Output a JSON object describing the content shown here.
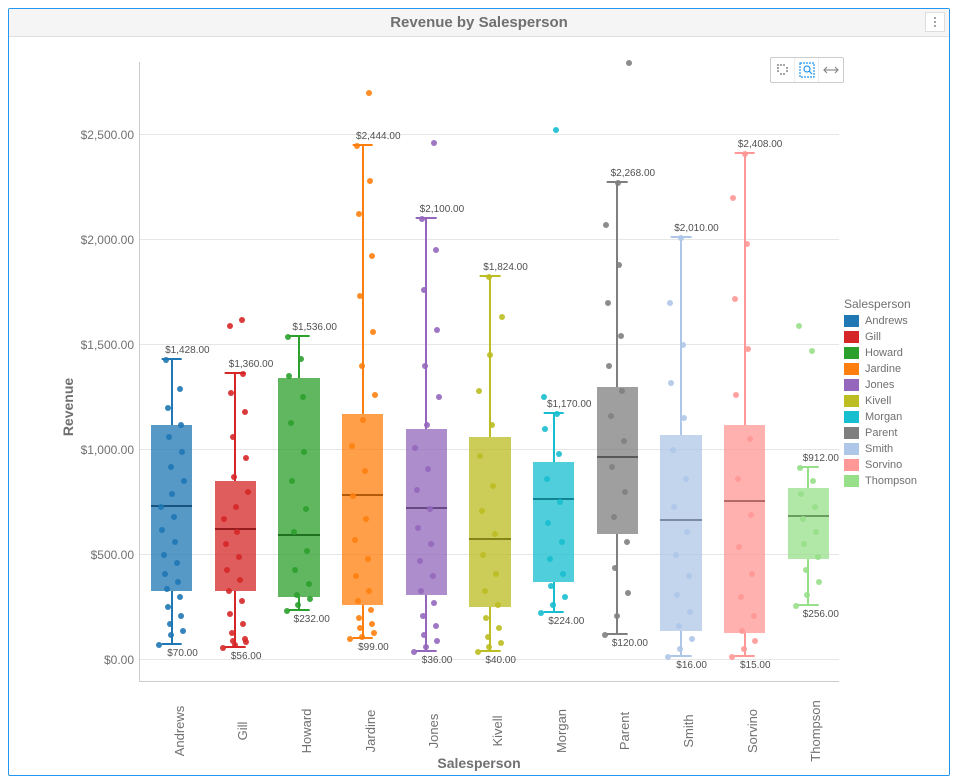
{
  "title": "Revenue by Salesperson",
  "y_axis_title": "Revenue",
  "x_axis_title": "Salesperson",
  "legend_title": "Salesperson",
  "y_ticks": [
    {
      "v": 0,
      "label": "$0.00"
    },
    {
      "v": 500,
      "label": "$500.00"
    },
    {
      "v": 1000,
      "label": "$1,000.00"
    },
    {
      "v": 1500,
      "label": "$1,500.00"
    },
    {
      "v": 2000,
      "label": "$2,000.00"
    },
    {
      "v": 2500,
      "label": "$2,500.00"
    }
  ],
  "chart_data": {
    "type": "boxplot",
    "xlabel": "Salesperson",
    "ylabel": "Revenue",
    "title": "Revenue by Salesperson",
    "ylim": [
      -100,
      2850
    ],
    "series": [
      {
        "name": "Andrews",
        "color": "#1f77b4",
        "min": 70,
        "q1": 330,
        "median": 730,
        "q3": 1120,
        "max": 1428,
        "max_label": "$1,428.00",
        "min_label": "$70.00",
        "points": [
          70,
          120,
          140,
          170,
          210,
          250,
          300,
          340,
          370,
          410,
          460,
          500,
          560,
          620,
          680,
          730,
          790,
          850,
          920,
          990,
          1060,
          1120,
          1200,
          1290,
          1428
        ]
      },
      {
        "name": "Gill",
        "color": "#d62728",
        "min": 56,
        "q1": 330,
        "median": 620,
        "q3": 850,
        "max": 1360,
        "max_label": "$1,360.00",
        "min_label": "$56.00",
        "points": [
          56,
          70,
          85,
          90,
          100,
          130,
          170,
          220,
          280,
          330,
          380,
          430,
          490,
          550,
          610,
          670,
          730,
          800,
          870,
          960,
          1060,
          1180,
          1270,
          1360,
          1590,
          1620
        ],
        "outliers": [
          1590,
          1620
        ]
      },
      {
        "name": "Howard",
        "color": "#2ca02c",
        "min": 232,
        "q1": 300,
        "median": 590,
        "q3": 1340,
        "max": 1536,
        "max_label": "$1,536.00",
        "min_label": "$232.00",
        "points": [
          232,
          260,
          290,
          310,
          360,
          430,
          520,
          610,
          720,
          850,
          990,
          1130,
          1250,
          1350,
          1430,
          1536
        ]
      },
      {
        "name": "Jardine",
        "color": "#ff7f0e",
        "min": 99,
        "q1": 260,
        "median": 780,
        "q3": 1170,
        "max": 2444,
        "max_label": "$2,444.00",
        "min_label": "$99.00",
        "points": [
          99,
          110,
          130,
          150,
          170,
          200,
          240,
          280,
          330,
          400,
          480,
          570,
          670,
          780,
          900,
          1020,
          1140,
          1260,
          1400,
          1560,
          1730,
          1920,
          2120,
          2280,
          2444,
          2700
        ],
        "outliers": [
          2700
        ]
      },
      {
        "name": "Jones",
        "color": "#9467bd",
        "min": 36,
        "q1": 310,
        "median": 720,
        "q3": 1100,
        "max": 2100,
        "max_label": "$2,100.00",
        "min_label": "$36.00",
        "points": [
          36,
          60,
          90,
          120,
          160,
          210,
          270,
          330,
          400,
          470,
          550,
          630,
          720,
          810,
          910,
          1010,
          1120,
          1250,
          1400,
          1570,
          1760,
          1950,
          2100,
          2460
        ],
        "outliers": [
          2460
        ]
      },
      {
        "name": "Kivell",
        "color": "#bcbd22",
        "min": 40,
        "q1": 250,
        "median": 570,
        "q3": 1060,
        "max": 1824,
        "max_label": "$1,824.00",
        "min_label": "$40.00",
        "points": [
          40,
          60,
          80,
          110,
          150,
          200,
          260,
          330,
          410,
          500,
          600,
          710,
          830,
          970,
          1120,
          1280,
          1450,
          1630,
          1824
        ]
      },
      {
        "name": "Morgan",
        "color": "#17becf",
        "min": 224,
        "q1": 370,
        "median": 760,
        "q3": 940,
        "max": 1170,
        "max_label": "$1,170.00",
        "min_label": "$224.00",
        "points": [
          224,
          260,
          300,
          350,
          410,
          480,
          560,
          650,
          750,
          860,
          980,
          1100,
          1170,
          1250,
          2520
        ],
        "outliers": [
          1250,
          2520
        ]
      },
      {
        "name": "Parent",
        "color": "#7f7f7f",
        "min": 120,
        "q1": 600,
        "median": 960,
        "q3": 1300,
        "max": 2268,
        "max_label": "$2,268.00",
        "min_label": "$120.00",
        "points": [
          120,
          210,
          320,
          440,
          560,
          680,
          800,
          920,
          1040,
          1160,
          1280,
          1400,
          1540,
          1700,
          1880,
          2070,
          2268,
          2840
        ],
        "outliers": [
          2840
        ]
      },
      {
        "name": "Smith",
        "color": "#aec7e8",
        "min": 16,
        "q1": 140,
        "median": 660,
        "q3": 1070,
        "max": 2010,
        "max_label": "$2,010.00",
        "min_label": "$16.00",
        "points": [
          16,
          50,
          100,
          160,
          230,
          310,
          400,
          500,
          610,
          730,
          860,
          1000,
          1150,
          1320,
          1500,
          1700,
          2010
        ]
      },
      {
        "name": "Sorvino",
        "color": "#ff9896",
        "min": 15,
        "q1": 130,
        "median": 750,
        "q3": 1120,
        "max": 2408,
        "max_label": "$2,408.00",
        "min_label": "$15.00",
        "points": [
          15,
          50,
          90,
          140,
          210,
          300,
          410,
          540,
          690,
          860,
          1050,
          1260,
          1480,
          1720,
          1980,
          2200,
          2408
        ]
      },
      {
        "name": "Thompson",
        "color": "#98df8a",
        "min": 256,
        "q1": 480,
        "median": 680,
        "q3": 820,
        "max": 912,
        "max_label": "$912.00",
        "min_label": "$256.00",
        "points": [
          256,
          310,
          370,
          430,
          490,
          550,
          610,
          670,
          730,
          790,
          850,
          912,
          1470,
          1590
        ],
        "outliers": [
          1470,
          1590
        ]
      }
    ]
  }
}
